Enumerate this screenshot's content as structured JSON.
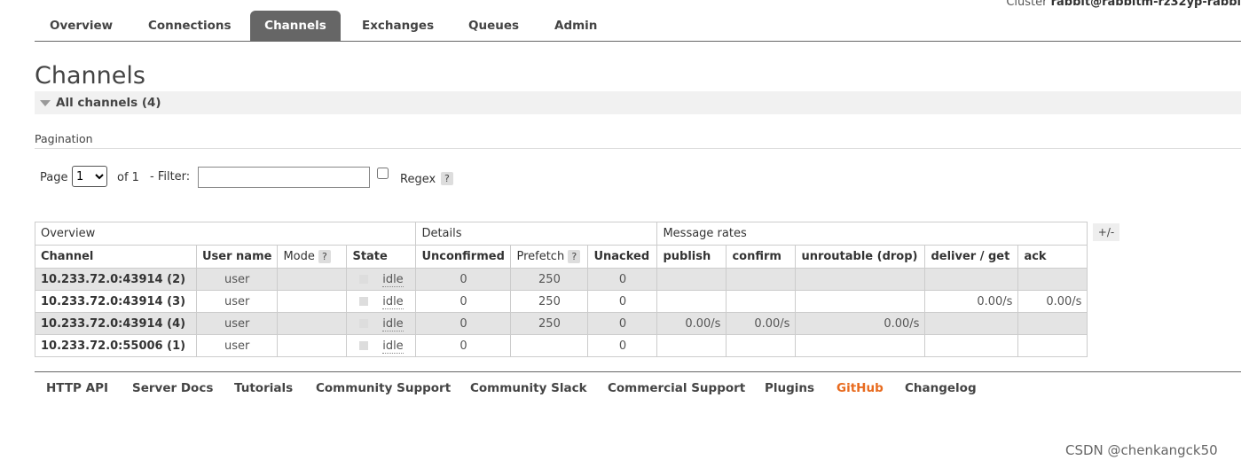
{
  "cluster": {
    "label": "Cluster",
    "name": "rabbit@rabbitm-rz32yp-rabbi"
  },
  "nav": {
    "tabs": [
      {
        "label": "Overview"
      },
      {
        "label": "Connections"
      },
      {
        "label": "Channels"
      },
      {
        "label": "Exchanges"
      },
      {
        "label": "Queues"
      },
      {
        "label": "Admin"
      }
    ],
    "active": "Channels"
  },
  "page_title": "Channels",
  "section": {
    "title": "All channels (4)"
  },
  "pagination": {
    "label": "Pagination",
    "page_label": "Page",
    "page_value": "1",
    "of_label": "of 1",
    "filter_label": "- Filter:",
    "filter_value": "",
    "regex_label": "Regex",
    "help": "?"
  },
  "table": {
    "groups": [
      "Overview",
      "Details",
      "Message rates"
    ],
    "columns": {
      "channel": "Channel",
      "user": "User name",
      "mode": "Mode",
      "state": "State",
      "unconfirmed": "Unconfirmed",
      "prefetch": "Prefetch",
      "unacked": "Unacked",
      "publish": "publish",
      "confirm": "confirm",
      "unroutable": "unroutable (drop)",
      "deliver": "deliver / get",
      "ack": "ack"
    },
    "rows": [
      {
        "channel": "10.233.72.0:43914 (2)",
        "user": "user",
        "mode": "",
        "state": "idle",
        "unconfirmed": "0",
        "prefetch": "250",
        "unacked": "0",
        "publish": "",
        "confirm": "",
        "unroutable": "",
        "deliver": "",
        "ack": ""
      },
      {
        "channel": "10.233.72.0:43914 (3)",
        "user": "user",
        "mode": "",
        "state": "idle",
        "unconfirmed": "0",
        "prefetch": "250",
        "unacked": "0",
        "publish": "",
        "confirm": "",
        "unroutable": "",
        "deliver": "0.00/s",
        "ack": "0.00/s"
      },
      {
        "channel": "10.233.72.0:43914 (4)",
        "user": "user",
        "mode": "",
        "state": "idle",
        "unconfirmed": "0",
        "prefetch": "250",
        "unacked": "0",
        "publish": "0.00/s",
        "confirm": "0.00/s",
        "unroutable": "0.00/s",
        "deliver": "",
        "ack": ""
      },
      {
        "channel": "10.233.72.0:55006 (1)",
        "user": "user",
        "mode": "",
        "state": "idle",
        "unconfirmed": "0",
        "prefetch": "",
        "unacked": "0",
        "publish": "",
        "confirm": "",
        "unroutable": "",
        "deliver": "",
        "ack": ""
      }
    ],
    "toggle": "+/-"
  },
  "footer": {
    "links": [
      "HTTP API",
      "Server Docs",
      "Tutorials",
      "Community Support",
      "Community Slack",
      "Commercial Support",
      "Plugins",
      "GitHub",
      "Changelog"
    ],
    "highlight_color": "#e86b1f"
  },
  "watermark": "CSDN @chenkangck50"
}
